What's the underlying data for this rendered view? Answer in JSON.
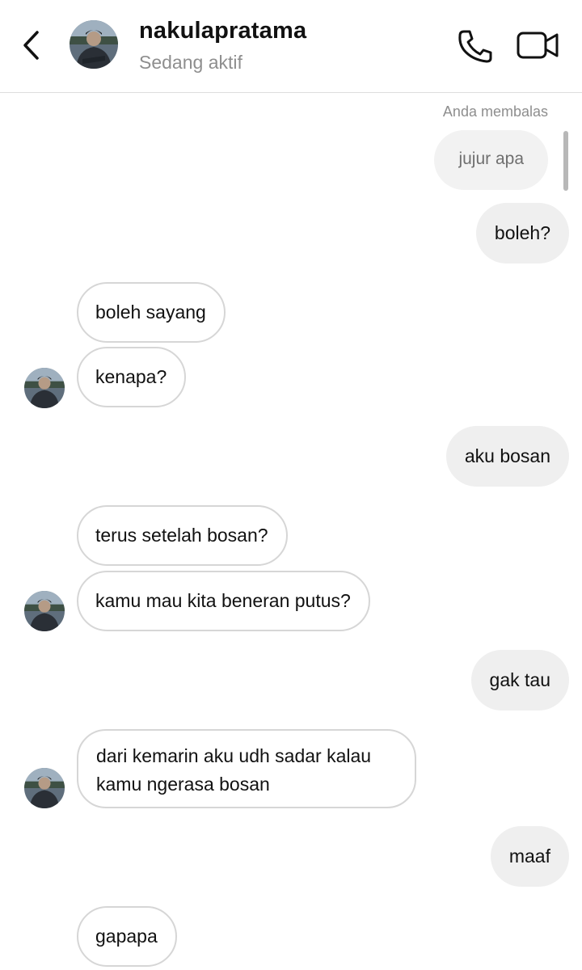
{
  "header": {
    "username": "nakulapratama",
    "status": "Sedang aktif"
  },
  "thread": {
    "reply_note": "Anda membalas",
    "quoted_message": "jujur apa",
    "messages": [
      {
        "from": "me",
        "text": "boleh?"
      },
      {
        "from": "them",
        "text": "boleh sayang"
      },
      {
        "from": "them",
        "text": "kenapa?"
      },
      {
        "from": "me",
        "text": "aku bosan"
      },
      {
        "from": "them",
        "text": "terus setelah bosan?"
      },
      {
        "from": "them",
        "text": "kamu mau kita beneran putus?"
      },
      {
        "from": "me",
        "text": "gak tau"
      },
      {
        "from": "them",
        "text": "dari kemarin aku udh sadar kalau kamu ngerasa bosan"
      },
      {
        "from": "me",
        "text": "maaf"
      },
      {
        "from": "them",
        "text": "gapapa"
      }
    ]
  },
  "colors": {
    "incoming_border": "#d6d6d6",
    "outgoing_bg": "#efefef",
    "secondary_text": "#8e8e8e"
  },
  "icons": [
    "back-chevron-icon",
    "phone-icon",
    "video-camera-icon"
  ]
}
